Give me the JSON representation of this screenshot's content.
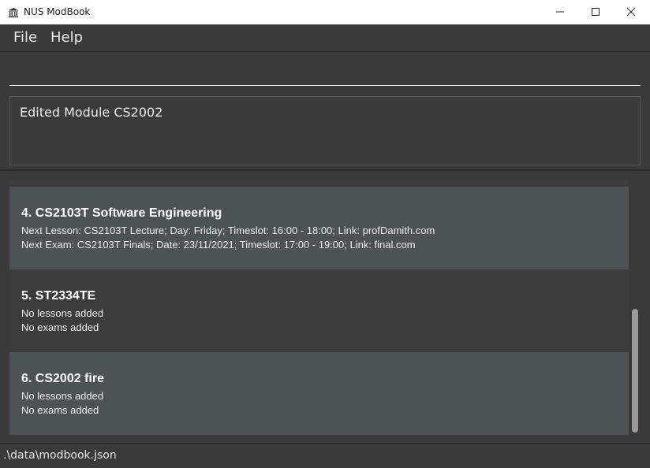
{
  "window": {
    "title": "NUS ModBook",
    "icon": "institution-icon"
  },
  "menu": {
    "items": [
      {
        "label": "File"
      },
      {
        "label": "Help"
      }
    ]
  },
  "command": {
    "value": "",
    "placeholder": ""
  },
  "result": {
    "message": "Edited Module CS2002"
  },
  "modules": [
    {
      "title": "4.  CS2103T Software Engineering",
      "line1": "Next Lesson: CS2103T Lecture; Day: Friday; Timeslot: 16:00 - 18:00; Link: profDamith.com",
      "line2": "Next Exam: CS2103T Finals; Date: 23/11/2021; Timeslot: 17:00 - 19:00; Link: final.com"
    },
    {
      "title": "5.  ST2334TE",
      "line1": "No lessons added",
      "line2": "No exams added"
    },
    {
      "title": "6.  CS2002 fire",
      "line1": "No lessons added",
      "line2": "No exams added"
    }
  ],
  "status": {
    "path": ".\\data\\modbook.json"
  },
  "colors": {
    "background": "#3a3a3a",
    "card_light": "#4c5356",
    "card_dark": "#3c3c3c",
    "scroll_thumb": "#9a9a9a"
  }
}
